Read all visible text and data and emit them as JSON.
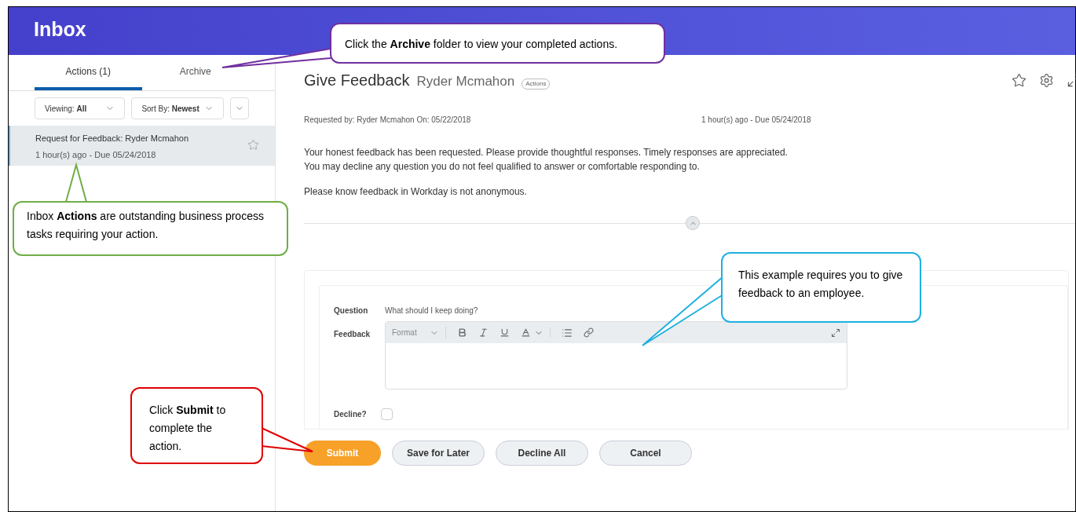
{
  "header": {
    "title": "Inbox"
  },
  "tabs": [
    {
      "label": "Actions (1)",
      "selected": true
    },
    {
      "label": "Archive",
      "selected": false
    }
  ],
  "filters": [
    {
      "label": "Viewing:",
      "value": "All"
    },
    {
      "label": "Sort By:",
      "value": "Newest"
    }
  ],
  "inbox_items": [
    {
      "title": "Request for Feedback: Ryder Mcmahon",
      "meta": "1 hour(s) ago - Due 05/24/2018",
      "selected": true,
      "starred": false
    }
  ],
  "detail": {
    "title": "Give Feedback",
    "subject": "Ryder Mcmahon",
    "tag": "Actions",
    "requested_by": "Requested by: Ryder Mcmahon On: 05/22/2018",
    "due": "1 hour(s) ago - Due 05/24/2018",
    "paragraphs": [
      "Your honest feedback has been requested. Please provide thoughtful responses. Timely responses are appreciated.\nYou may decline any question you do not feel qualified to answer or comfortable responding to.",
      "Please know feedback in Workday is not anonymous."
    ],
    "form": {
      "question_label": "Question",
      "question": "What should I keep doing?",
      "feedback_label": "Feedback",
      "format_placeholder": "Format",
      "decline_label": "Decline?",
      "decline_checked": false
    }
  },
  "buttons": [
    {
      "label": "Submit",
      "kind": "primary"
    },
    {
      "label": "Save for Later",
      "kind": "secondary"
    },
    {
      "label": "Decline All",
      "kind": "secondary"
    },
    {
      "label": "Cancel",
      "kind": "secondary"
    }
  ],
  "callouts": [
    {
      "text": "Click the **Archive** folder to view your completed actions.",
      "color": "#7030a0"
    },
    {
      "text": "Inbox **Actions** are outstanding business process tasks requiring your action.",
      "color": "#70ad47"
    },
    {
      "text": "This example requires you to give feedback to an employee.",
      "color": "#1fb0e0"
    },
    {
      "text": "Click **Submit** to complete the action.",
      "color": "#e00000"
    }
  ]
}
